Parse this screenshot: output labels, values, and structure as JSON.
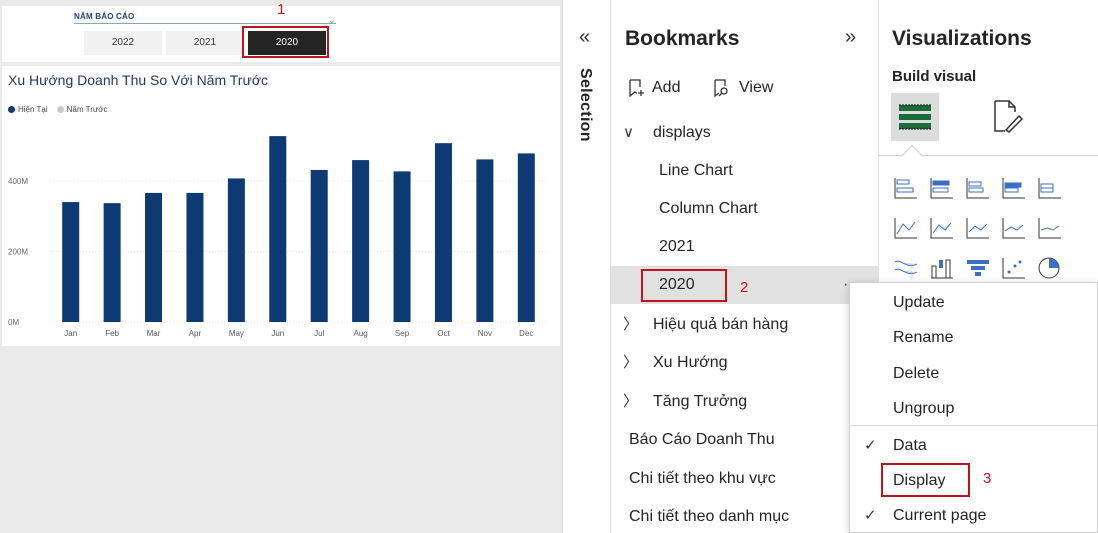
{
  "slicer": {
    "title": "NĂM BÁO CÁO",
    "years": [
      "2022",
      "2021",
      "2020"
    ],
    "selected": "2020"
  },
  "annotations": {
    "n1": "1",
    "n2": "2",
    "n3": "3"
  },
  "chart_data": {
    "type": "bar",
    "title": "Xu Hướng Doanh Thu So Với Năm Trước",
    "legend": [
      "Hiện Tại",
      "Năm Trước"
    ],
    "legend_colors": [
      "#0d3a73",
      "#c8c8c8"
    ],
    "categories": [
      "Jan",
      "Feb",
      "Mar",
      "Apr",
      "May",
      "Jun",
      "Jul",
      "Aug",
      "Sep",
      "Oct",
      "Nov",
      "Dec"
    ],
    "series": [
      {
        "name": "Hiện Tại",
        "color": "#0d3a73",
        "values": [
          340,
          337,
          366,
          366,
          407,
          527,
          431,
          459,
          427,
          507,
          461,
          478
        ]
      }
    ],
    "yticks": [
      "0M",
      "200M",
      "400M"
    ],
    "ytick_values": [
      0,
      200,
      400
    ],
    "ylim": [
      0,
      550
    ],
    "grid": true
  },
  "selection": {
    "label": "Selection",
    "expand_icon": "«"
  },
  "bookmarks": {
    "title": "Bookmarks",
    "collapse_icon": "»",
    "add_label": "Add",
    "view_label": "View",
    "group": "displays",
    "items": [
      {
        "label": "Line Chart"
      },
      {
        "label": "Column Chart"
      },
      {
        "label": "2021"
      },
      {
        "label": "2020"
      }
    ],
    "groups": [
      {
        "label": "Hiệu quả bán hàng"
      },
      {
        "label": "Xu Hướng"
      },
      {
        "label": "Tăng Trưởng"
      }
    ],
    "standalone": [
      {
        "label": "Báo Cáo Doanh Thu"
      },
      {
        "label": "Chi tiết theo khu vực"
      },
      {
        "label": "Chi tiết theo danh mục"
      }
    ],
    "more_icon": "···"
  },
  "visualizations": {
    "title": "Visualizations",
    "subtitle": "Build visual"
  },
  "context_menu": {
    "items": [
      {
        "label": "Update",
        "checked": false
      },
      {
        "label": "Rename",
        "checked": false
      },
      {
        "label": "Delete",
        "checked": false
      },
      {
        "label": "Ungroup",
        "checked": false
      },
      {
        "label": "Data",
        "checked": true
      },
      {
        "label": "Display",
        "checked": false
      },
      {
        "label": "Current page",
        "checked": true
      }
    ],
    "check_glyph": "✓"
  },
  "colors": {
    "accent_red": "#c0131b",
    "bar_navy": "#0d3a73"
  }
}
